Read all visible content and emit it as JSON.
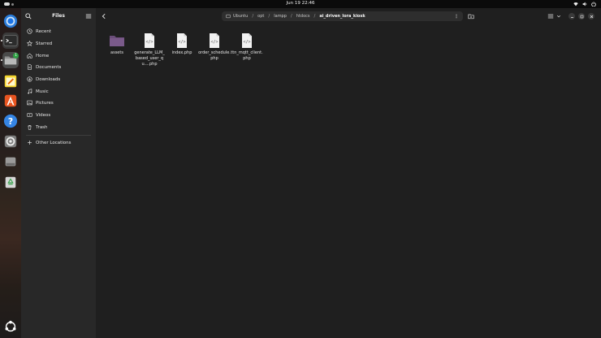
{
  "topbar": {
    "clock": "Jun 19  22:46",
    "tray_icons": [
      "wifi-icon",
      "volume-icon",
      "power-icon"
    ]
  },
  "dock": {
    "apps": [
      "chrome-icon",
      "terminal-icon",
      "files-icon",
      "text-editor-icon",
      "app-center-icon",
      "help-icon",
      "settings-icon",
      "drive-icon",
      "trash-icon"
    ],
    "files_badge": "1",
    "show_apps": "show-apps-icon"
  },
  "sidebar": {
    "title": "Files",
    "items": [
      {
        "label": "Recent",
        "icon": "clock-icon"
      },
      {
        "label": "Starred",
        "icon": "star-icon"
      },
      {
        "label": "Home",
        "icon": "home-icon"
      },
      {
        "label": "Documents",
        "icon": "document-icon"
      },
      {
        "label": "Downloads",
        "icon": "download-icon"
      },
      {
        "label": "Music",
        "icon": "music-icon"
      },
      {
        "label": "Pictures",
        "icon": "picture-icon"
      },
      {
        "label": "Videos",
        "icon": "video-icon"
      },
      {
        "label": "Trash",
        "icon": "trash-icon"
      }
    ],
    "other_locations": "Other Locations"
  },
  "pathbar": {
    "crumbs": [
      "Ubuntu",
      "opt",
      "lampp",
      "htdocs"
    ],
    "current": "ai_driven_lora_kiosk"
  },
  "files": [
    {
      "name": "assets",
      "type": "folder"
    },
    {
      "name": "generate_LLM_based_user_qu....php",
      "type": "php"
    },
    {
      "name": "index.php",
      "type": "php"
    },
    {
      "name": "order_schedule.php",
      "type": "php"
    },
    {
      "name": "ttn_mqtt_client.php",
      "type": "php"
    }
  ],
  "colors": {
    "folder": "#7a5a8a",
    "accent": "#e95420",
    "sidebar_bg": "#282828",
    "main_bg": "#1f1f1f"
  }
}
